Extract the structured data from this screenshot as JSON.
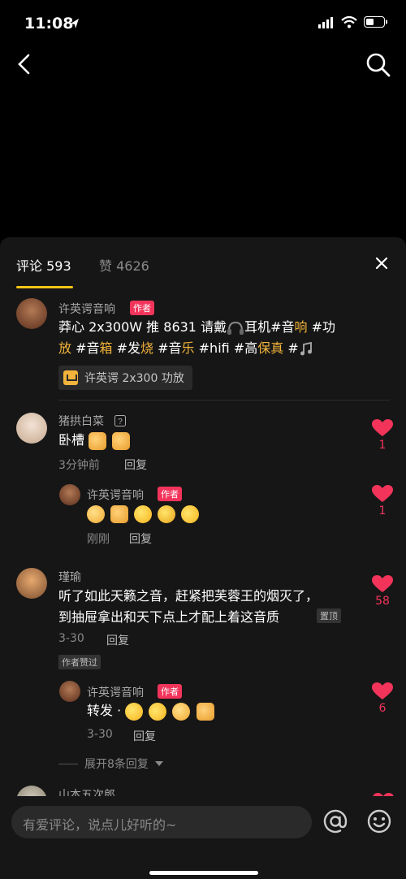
{
  "status": {
    "time": "11:08"
  },
  "tabs": {
    "comments_label": "评论 593",
    "likes_label": "赞 4626"
  },
  "comments": [
    {
      "user": "许英谔音响",
      "badge": "作者",
      "text_parts": [
        "莽心 2x300W 推 8631 请戴",
        "耳机#音",
        "响",
        " #功",
        "放",
        " #音",
        "箱",
        " #发",
        "烧",
        " #音",
        "乐",
        " #hifi #高",
        "保真",
        " #"
      ],
      "product": "许英谔 2x300 功放"
    },
    {
      "user": "猪拱白菜",
      "text": "卧槽",
      "time": "3分钟前",
      "reply": "回复",
      "likes": "1",
      "replies": [
        {
          "user": "许英谔音响",
          "badge": "作者",
          "time": "刚刚",
          "reply": "回复",
          "likes": "1"
        }
      ]
    },
    {
      "user": "瑾瑜",
      "text_line1": "听了如此天籁之音，赶紧把芙蓉王的烟灭了，",
      "text_line2": "到抽屉拿出和天下点上才配上着这音质",
      "pinned": "置顶",
      "time": "3-30",
      "reply": "回复",
      "liked_tag": "作者赞过",
      "likes": "58",
      "replies": [
        {
          "user": "许英谔音响",
          "badge": "作者",
          "text": "转发 · ",
          "time": "3-30",
          "reply": "回复",
          "likes": "6"
        }
      ],
      "expand": "展开8条回复"
    },
    {
      "user": "山本五次郎"
    }
  ],
  "input": {
    "placeholder": "有爱评论，说点儿好听的~"
  },
  "colors": {
    "accent_yellow": "#f5c518",
    "like_red": "#f2345b",
    "tag_orange": "#f2b43a"
  }
}
